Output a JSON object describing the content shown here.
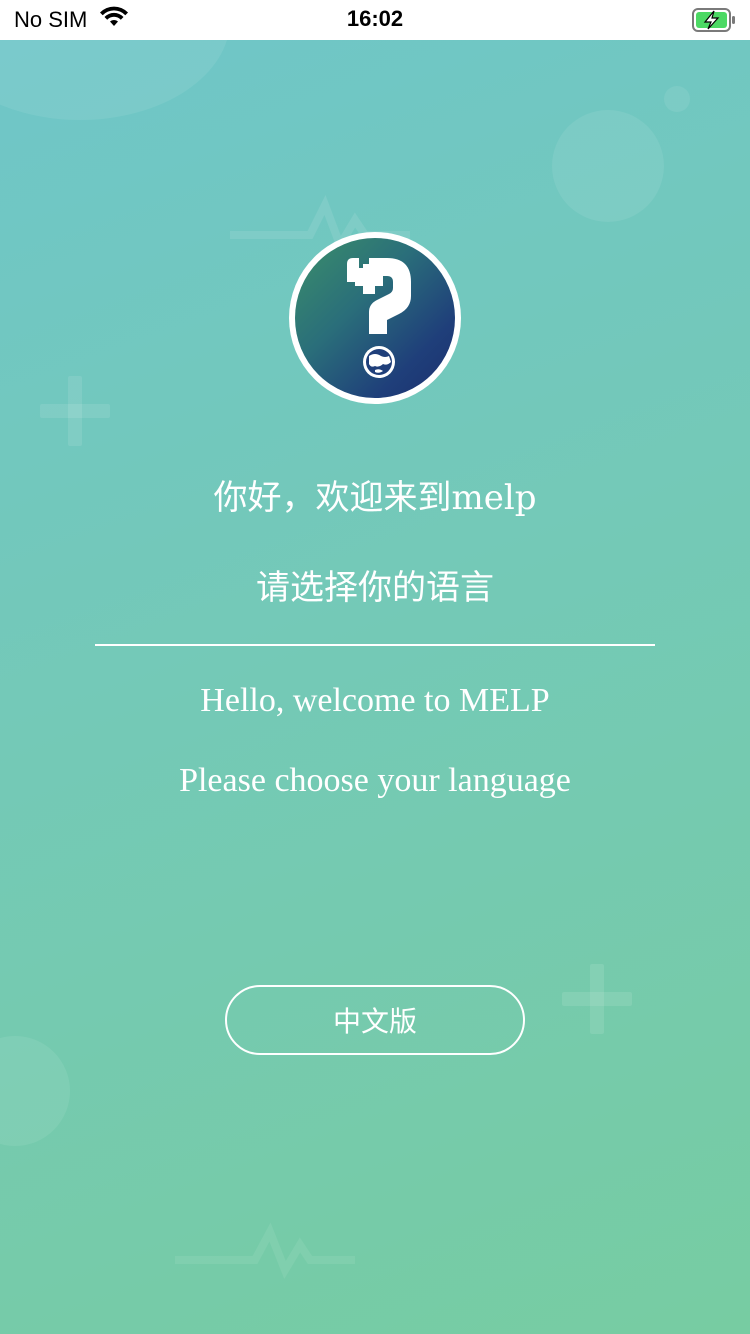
{
  "status_bar": {
    "carrier": "No SIM",
    "time": "16:02",
    "wifi_icon": "wifi-icon",
    "battery_icon": "battery-charging-icon",
    "battery_color": "#4cd964"
  },
  "logo": {
    "icon": "medical-question-globe-icon"
  },
  "welcome": {
    "greeting_cn": "你好，欢迎来到melp",
    "choose_cn": "请选择你的语言",
    "greeting_en": "Hello, welcome to MELP",
    "choose_en": "Please choose your language"
  },
  "language_button": {
    "label": "中文版"
  },
  "colors": {
    "gradient_start": "#6fc6c8",
    "gradient_end": "#77cca2",
    "text": "#ffffff"
  }
}
